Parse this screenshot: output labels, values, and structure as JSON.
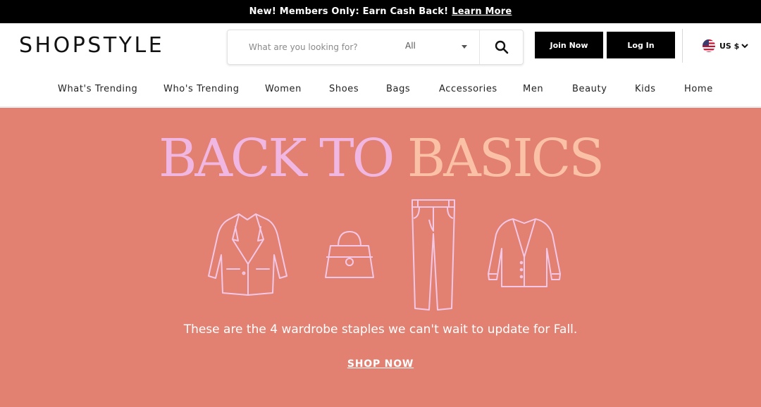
{
  "promo": {
    "text": "New! Members Only: Earn Cash Back!",
    "link": "Learn More"
  },
  "header": {
    "logo": "SHOPSTYLE",
    "search": {
      "placeholder": "What are you looking for?",
      "category": "All"
    },
    "join_label": "Join Now",
    "login_label": "Log In",
    "currency": "US $",
    "icons": {
      "search": "search-icon",
      "flag": "us-flag-icon",
      "chevron": "chevron-down-icon"
    }
  },
  "nav": [
    "What's Trending",
    "Who's Trending",
    "Women",
    "Shoes",
    "Bags",
    "Accessories",
    "Men",
    "Beauty",
    "Kids",
    "Home"
  ],
  "hero": {
    "title_part1": "BACK TO",
    "title_part2": "BASICS",
    "subtitle": "These are the 4 wardrobe staples we can't wait to update for Fall.",
    "cta": "SHOP NOW",
    "illustrations": [
      "blazer-icon",
      "handbag-icon",
      "jeans-icon",
      "cardigan-icon"
    ],
    "colors": {
      "background": "#e28172",
      "title1": "#f0b7e2",
      "title2": "#fbc1a7",
      "line": "#f3c8e6"
    }
  }
}
